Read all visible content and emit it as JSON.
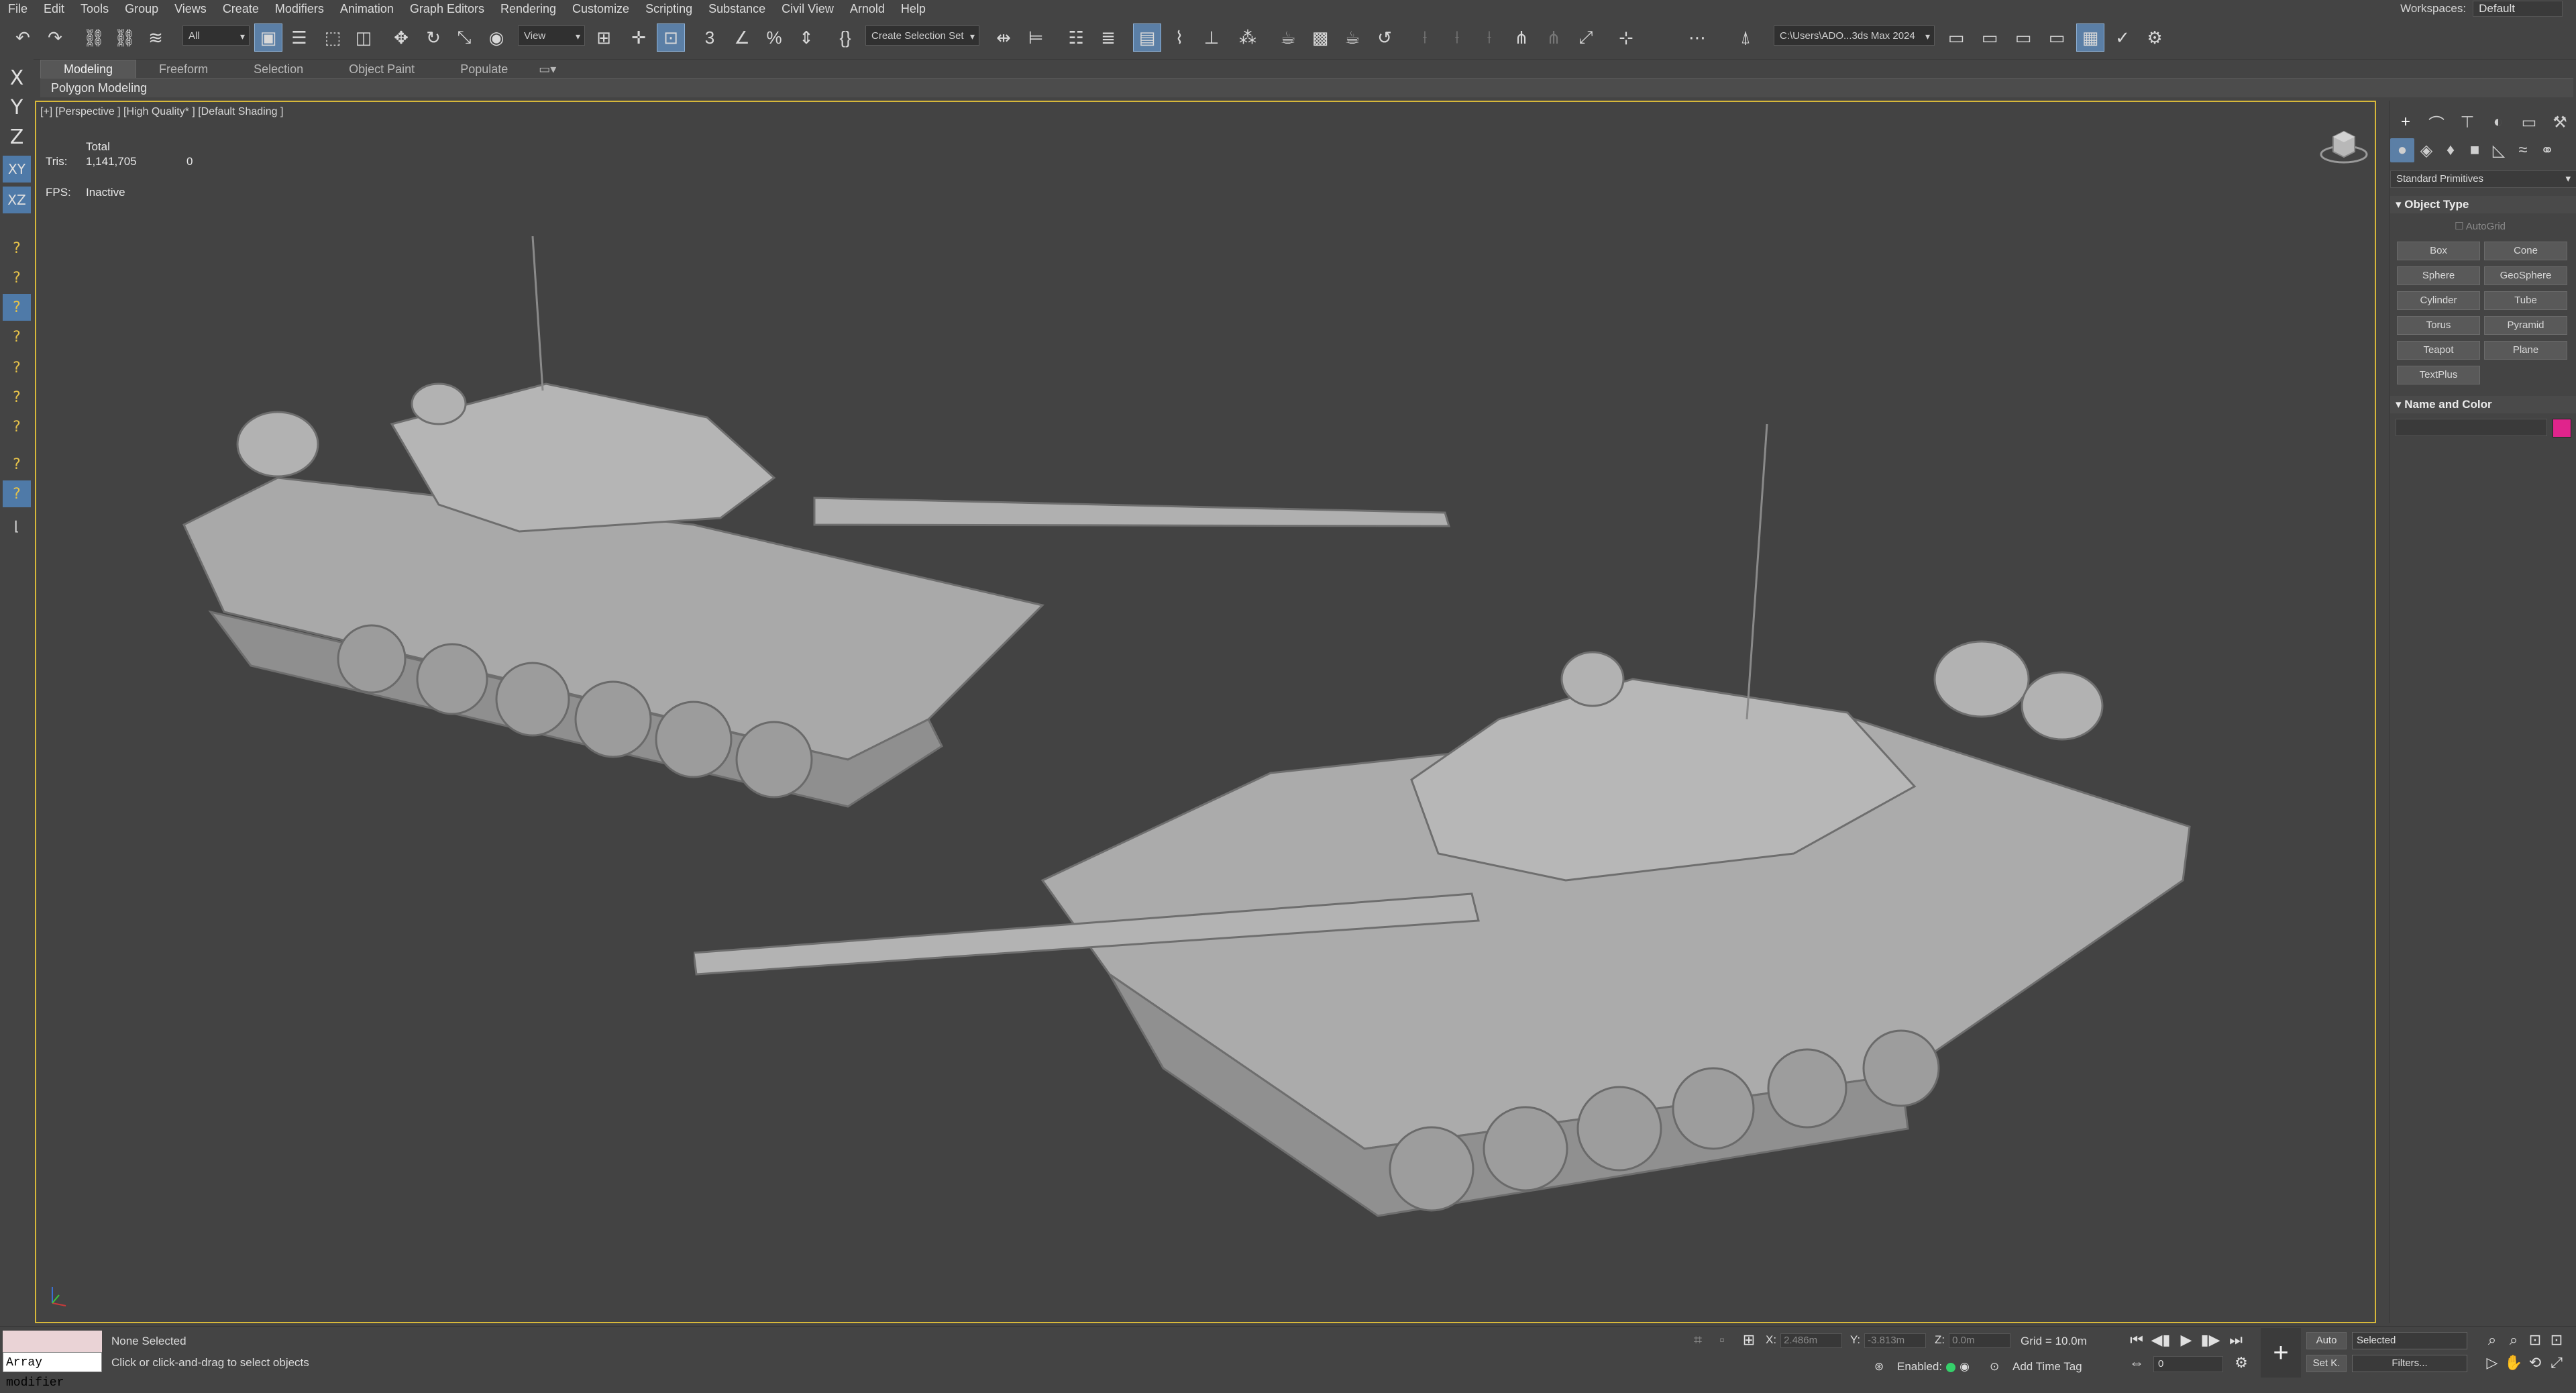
{
  "menu": [
    "File",
    "Edit",
    "Tools",
    "Group",
    "Views",
    "Create",
    "Modifiers",
    "Animation",
    "Graph Editors",
    "Rendering",
    "Customize",
    "Scripting",
    "Substance",
    "Civil View",
    "Arnold",
    "Help"
  ],
  "workspaces": {
    "label": "Workspaces:",
    "value": "Default"
  },
  "toolbar": {
    "selection_filter": "All",
    "ref_coord": "View",
    "named_selection": "Create Selection Set",
    "project_path": "C:\\Users\\ADO...3ds Max 2024"
  },
  "ribbon": {
    "tabs": [
      "Modeling",
      "Freeform",
      "Selection",
      "Object Paint",
      "Populate"
    ],
    "panel_label": "Polygon Modeling"
  },
  "left_toolbar": {
    "axes": [
      "X",
      "Y",
      "Z",
      "XY",
      "XZ"
    ]
  },
  "viewport": {
    "label": "[+] [Perspective ] [High Quality* ] [Default Shading ]",
    "stats": {
      "total_label": "Total",
      "tris_label": "Tris:",
      "tris_value": "1,141,705",
      "tris_sel": "0",
      "fps_label": "FPS:",
      "fps_value": "Inactive"
    }
  },
  "command_panel": {
    "category": "Standard Primitives",
    "object_type_title": "Object Type",
    "autogrid": "AutoGrid",
    "primitives": [
      "Box",
      "Cone",
      "Sphere",
      "GeoSphere",
      "Cylinder",
      "Tube",
      "Torus",
      "Pyramid",
      "Teapot",
      "Plane",
      "TextPlus"
    ],
    "name_color_title": "Name and Color",
    "object_color": "#e0248c"
  },
  "status": {
    "maxscript_text": "Array modifier",
    "selection": "None Selected",
    "prompt": "Click or click-and-drag to select objects",
    "x_label": "X:",
    "x_value": "2.486m",
    "y_label": "Y:",
    "y_value": "-3.813m",
    "z_label": "Z:",
    "z_value": "0.0m",
    "grid": "Grid = 10.0m",
    "enabled": "Enabled:",
    "add_time_tag": "Add Time Tag",
    "auto_key": "Auto",
    "set_key": "Set K.",
    "key_filter": "Selected",
    "filters": "Filters...",
    "frame": "0"
  }
}
